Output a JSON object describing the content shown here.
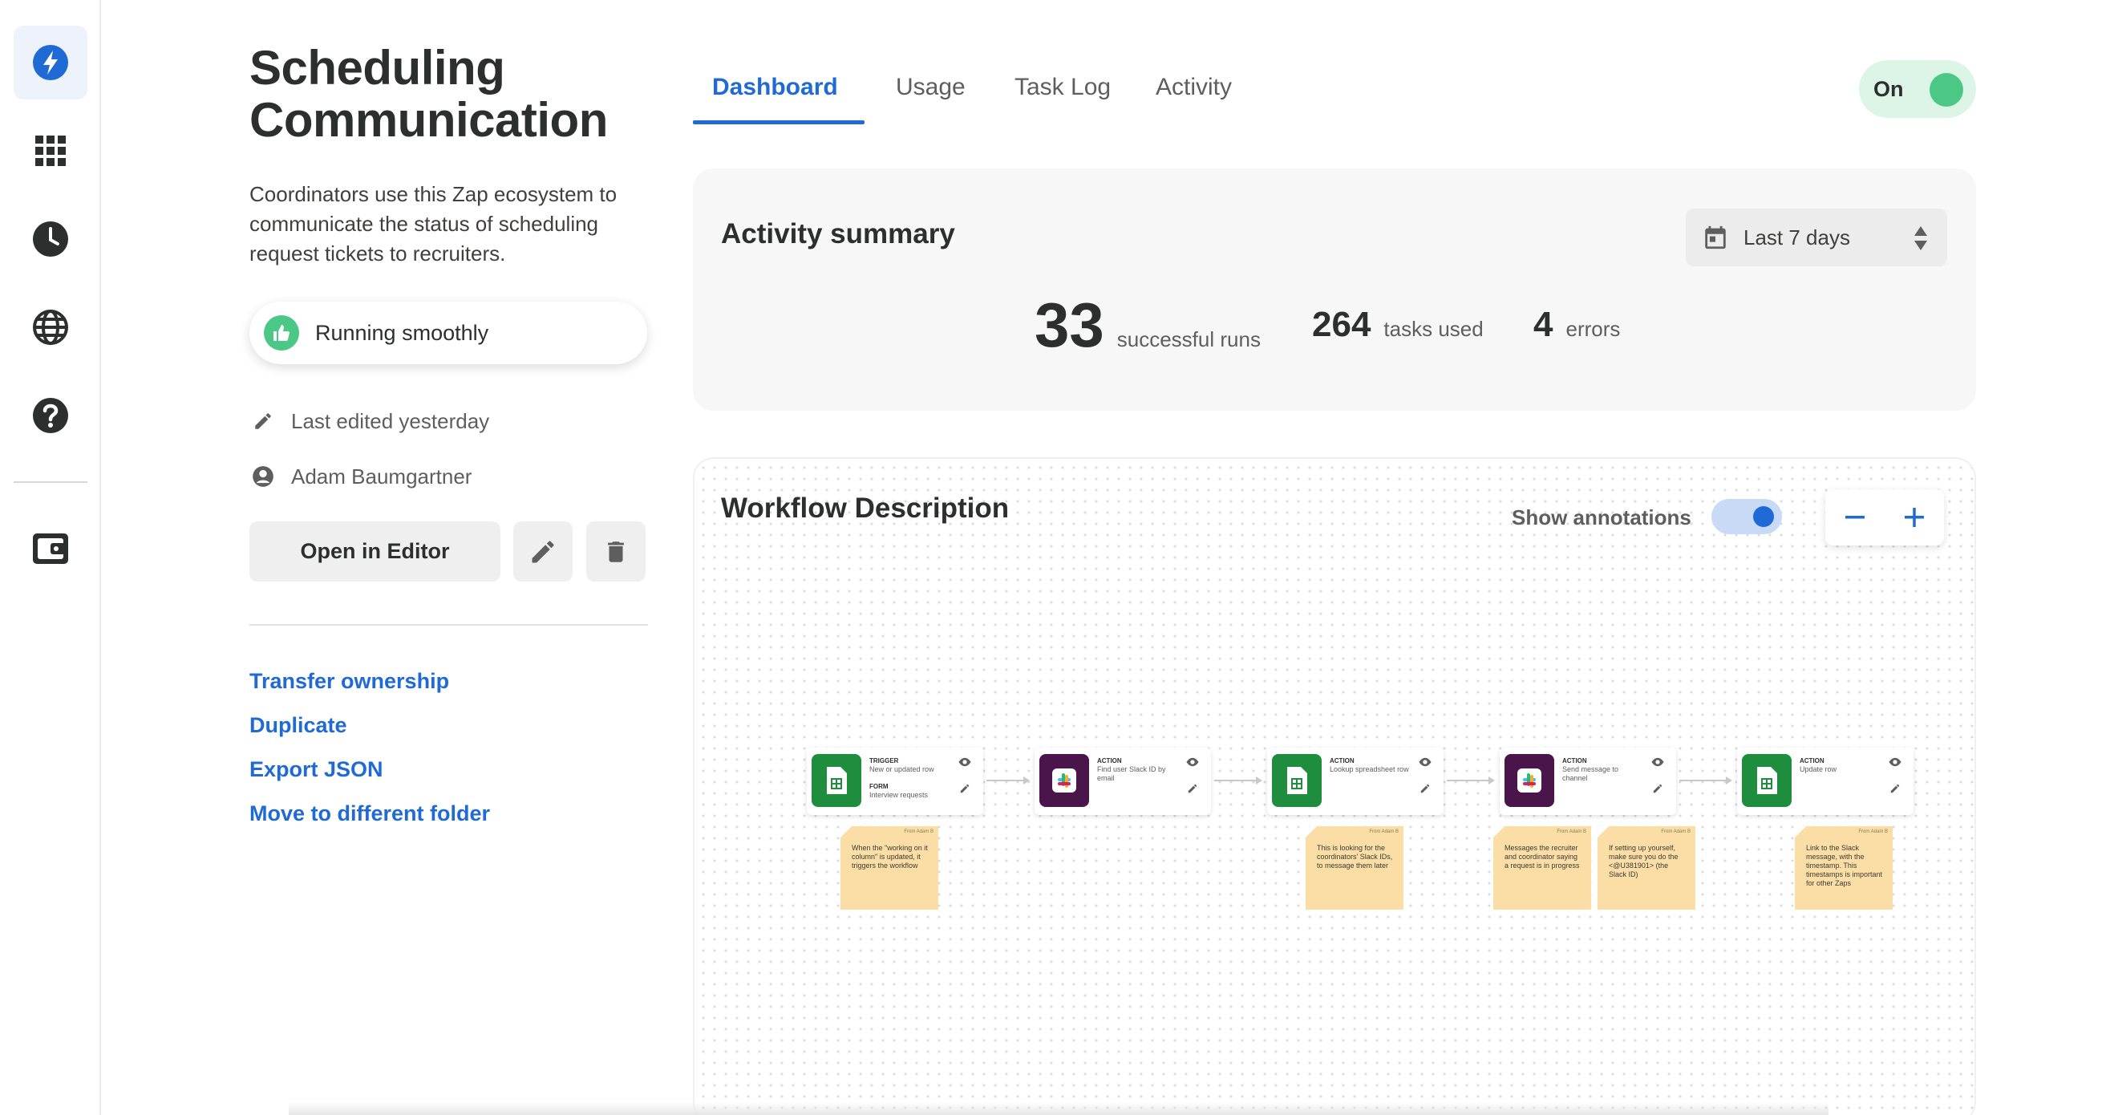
{
  "colors": {
    "accent": "#1f6ad4",
    "success": "#4cc886",
    "sheets": "#1e8e3e",
    "slack": "#4a154b",
    "note": "#fbdea6"
  },
  "rail": {
    "items": [
      {
        "icon": "lightning-icon",
        "active": true
      },
      {
        "icon": "apps-grid-icon"
      },
      {
        "icon": "clock-icon"
      },
      {
        "icon": "globe-icon"
      },
      {
        "icon": "help-icon"
      },
      {
        "icon": "wallet-icon"
      }
    ]
  },
  "zap": {
    "title": "Scheduling Communication",
    "description": "Coordinators use this Zap ecosystem to communicate the status of scheduling request tickets to recruiters.",
    "status": "Running smoothly",
    "last_edited": "Last edited yesterday",
    "owner": "Adam Baumgartner",
    "open_editor": "Open in Editor"
  },
  "links": [
    "Transfer ownership",
    "Duplicate",
    "Export JSON",
    "Move to different folder"
  ],
  "tabs": [
    {
      "label": "Dashboard",
      "active": true
    },
    {
      "label": "Usage"
    },
    {
      "label": "Task Log"
    },
    {
      "label": "Activity"
    }
  ],
  "toggle": {
    "label": "On",
    "state": true
  },
  "summary": {
    "title": "Activity summary",
    "range": "Last 7 days",
    "stats": [
      {
        "value": "33",
        "label": "successful runs"
      },
      {
        "value": "264",
        "label": "tasks used"
      },
      {
        "value": "4",
        "label": "errors"
      }
    ]
  },
  "workflow": {
    "title": "Workflow Description",
    "annotations_label": "Show annotations",
    "annotations_on": true,
    "steps": [
      {
        "kind": "TRIGGER",
        "text": "New or updated row",
        "sub_kind": "FORM",
        "sub_text": "Interview requests",
        "app": "sheets"
      },
      {
        "kind": "ACTION",
        "text": "Find user Slack ID by email",
        "app": "slack"
      },
      {
        "kind": "ACTION",
        "text": "Lookup spreadsheet row",
        "app": "sheets"
      },
      {
        "kind": "ACTION",
        "text": "Send message to channel",
        "app": "slack"
      },
      {
        "kind": "ACTION",
        "text": "Update row",
        "app": "sheets"
      }
    ],
    "notes": [
      {
        "author": "From Adam B",
        "text": "When the \"working on it column\" is updated, it triggers the workflow"
      },
      {
        "author": "From Adam B",
        "text": "This is looking for the coordinators' Slack IDs, to message them later"
      },
      {
        "author": "From Adam B",
        "text": "Messages the recruiter and coordinator saying a request is in progress"
      },
      {
        "author": "From Adam B",
        "text": "If setting up yourself, make sure you do the <@U381901> (the Slack ID)"
      },
      {
        "author": "From Adam B",
        "text": "Link to the Slack message, with the timestamp. This timestamps is important for other Zaps"
      }
    ]
  }
}
